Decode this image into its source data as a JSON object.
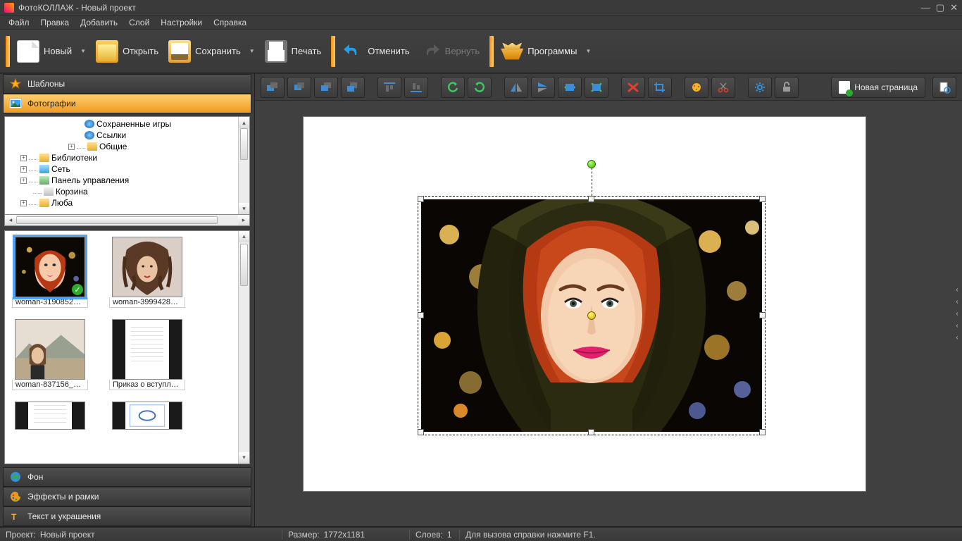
{
  "app_title": "ФотоКОЛЛАЖ - Новый проект",
  "menu": [
    "Файл",
    "Правка",
    "Добавить",
    "Слой",
    "Настройки",
    "Справка"
  ],
  "toolbar": {
    "new": "Новый",
    "open": "Открыть",
    "save": "Сохранить",
    "print": "Печать",
    "undo": "Отменить",
    "redo": "Вернуть",
    "programs": "Программы"
  },
  "left": {
    "tab_templates": "Шаблоны",
    "tab_photos": "Фотографии",
    "tab_background": "Фон",
    "tab_effects": "Эффекты и рамки",
    "tab_text": "Текст и украшения",
    "tree": [
      "Сохраненные игры",
      "Ссылки",
      "Общие",
      "Библиотеки",
      "Сеть",
      "Панель управления",
      "Корзина",
      "Люба"
    ],
    "thumbs": [
      "woman-3190852_…",
      "woman-3999428_…",
      "woman-837156_6…",
      "Приказ о вступл…"
    ]
  },
  "sec_toolbar": {
    "icons": [
      "layer-back",
      "layer-backward",
      "layer-forward",
      "layer-front",
      "align-top",
      "align-bottom",
      "rotate-ccw",
      "rotate-cw",
      "flip-h",
      "flip-v",
      "fit-width",
      "fit-height",
      "delete",
      "crop",
      "color-fx",
      "cut",
      "settings",
      "lock"
    ],
    "new_page": "Новая страница"
  },
  "status": {
    "project_label": "Проект:",
    "project_value": "Новый проект",
    "size_label": "Размер:",
    "size_value": "1772x1181",
    "layers_label": "Слоев:",
    "layers_value": "1",
    "help": "Для вызова справки нажмите F1."
  }
}
